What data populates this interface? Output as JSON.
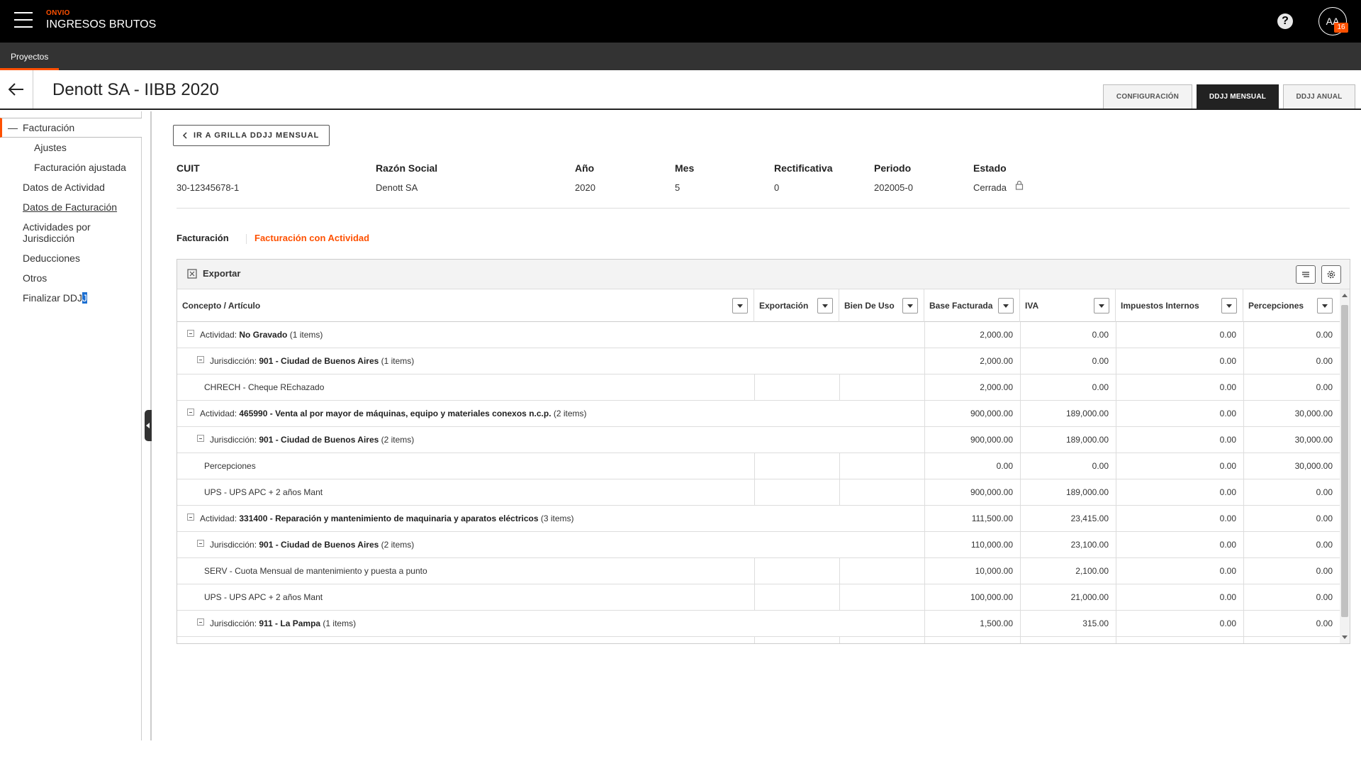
{
  "app": {
    "brand_small": "ONVIO",
    "brand_name": "INGRESOS BRUTOS",
    "help_symbol": "?",
    "avatar_initials": "AA",
    "avatar_badge": "16"
  },
  "subnav": {
    "tab": "Proyectos"
  },
  "header": {
    "title": "Denott SA - IIBB 2020",
    "tabs": [
      "CONFIGURACIÓN",
      "DDJJ MENSUAL",
      "DDJJ ANUAL"
    ],
    "active_tab": "DDJJ MENSUAL"
  },
  "sidebar": {
    "items": [
      "Facturación",
      "Ajustes",
      "Facturación ajustada",
      "Datos de Actividad",
      "Datos de Facturación",
      "Actividades por",
      "Jurisdicción",
      "Deducciones",
      "Otros",
      "Finalizar DDJ"
    ],
    "finalizar_sel": "J"
  },
  "main": {
    "grid_back_label": "IR A GRILLA DDJJ MENSUAL",
    "info": {
      "labels": [
        "CUIT",
        "Razón Social",
        "Año",
        "Mes",
        "Rectificativa",
        "Periodo",
        "Estado"
      ],
      "values": [
        "30-12345678-1",
        "Denott SA",
        "2020",
        "5",
        "0",
        "202005-0",
        "Cerrada"
      ]
    },
    "subtabs": [
      "Facturación",
      "Facturación con Actividad"
    ],
    "active_subtab": "Facturación con Actividad",
    "accent": "#fe5000"
  },
  "grid": {
    "export_label": "Exportar",
    "columns": [
      "Concepto / Artículo",
      "Exportación",
      "Bien De Uso",
      "Base Facturada",
      "IVA",
      "Impuestos Internos",
      "Percepciones"
    ],
    "rows": [
      {
        "level": 0,
        "prefix": "Actividad: ",
        "name": "No Gravado",
        "suffix": " (1 items)",
        "base": "2,000.00",
        "iva": "0.00",
        "imp": "0.00",
        "perc": "0.00"
      },
      {
        "level": 1,
        "prefix": "Jurisdicción: ",
        "name": "901 - Ciudad de Buenos Aires",
        "suffix": " (1 items)",
        "base": "2,000.00",
        "iva": "0.00",
        "imp": "0.00",
        "perc": "0.00"
      },
      {
        "level": 2,
        "prefix": "",
        "name": "CHRECH - Cheque REchazado",
        "suffix": "",
        "base": "2,000.00",
        "iva": "0.00",
        "imp": "0.00",
        "perc": "0.00"
      },
      {
        "level": 0,
        "prefix": "Actividad: ",
        "name": "465990 - Venta al por mayor de máquinas, equipo y materiales conexos n.c.p.",
        "suffix": " (2 items)",
        "base": "900,000.00",
        "iva": "189,000.00",
        "imp": "0.00",
        "perc": "30,000.00"
      },
      {
        "level": 1,
        "prefix": "Jurisdicción: ",
        "name": "901 - Ciudad de Buenos Aires",
        "suffix": " (2 items)",
        "base": "900,000.00",
        "iva": "189,000.00",
        "imp": "0.00",
        "perc": "30,000.00"
      },
      {
        "level": 2,
        "prefix": "",
        "name": "Percepciones",
        "suffix": "",
        "base": "0.00",
        "iva": "0.00",
        "imp": "0.00",
        "perc": "30,000.00"
      },
      {
        "level": 2,
        "prefix": "",
        "name": "UPS - UPS APC + 2 años Mant",
        "suffix": "",
        "base": "900,000.00",
        "iva": "189,000.00",
        "imp": "0.00",
        "perc": "0.00"
      },
      {
        "level": 0,
        "prefix": "Actividad: ",
        "name": "331400 - Reparación y mantenimiento de maquinaria y aparatos eléctricos",
        "suffix": " (3 items)",
        "base": "111,500.00",
        "iva": "23,415.00",
        "imp": "0.00",
        "perc": "0.00"
      },
      {
        "level": 1,
        "prefix": "Jurisdicción: ",
        "name": "901 - Ciudad de Buenos Aires",
        "suffix": " (2 items)",
        "base": "110,000.00",
        "iva": "23,100.00",
        "imp": "0.00",
        "perc": "0.00"
      },
      {
        "level": 2,
        "prefix": "",
        "name": "SERV - Cuota Mensual de mantenimiento y puesta a punto",
        "suffix": "",
        "base": "10,000.00",
        "iva": "2,100.00",
        "imp": "0.00",
        "perc": "0.00"
      },
      {
        "level": 2,
        "prefix": "",
        "name": "UPS - UPS APC + 2 años Mant",
        "suffix": "",
        "base": "100,000.00",
        "iva": "21,000.00",
        "imp": "0.00",
        "perc": "0.00"
      },
      {
        "level": 1,
        "prefix": "Jurisdicción: ",
        "name": "911 - La Pampa",
        "suffix": " (1 items)",
        "base": "1,500.00",
        "iva": "315.00",
        "imp": "0.00",
        "perc": "0.00"
      }
    ]
  }
}
